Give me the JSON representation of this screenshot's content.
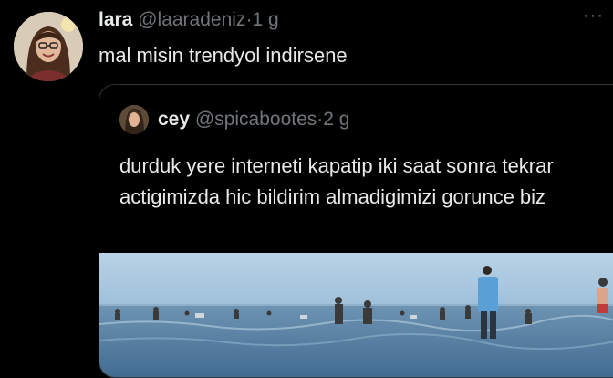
{
  "tweet": {
    "display_name": "lara",
    "handle": "@laaradeniz",
    "separator": "·",
    "time": "1 g",
    "text": "mal misin trendyol indirsene",
    "more_icon": "more-horizontal-icon"
  },
  "quoted": {
    "display_name": "cey",
    "handle": "@spicabootes",
    "separator": "·",
    "time": "2 g",
    "text": "durduk yere interneti kapatip iki saat sonra tekrar actigimizda hic bildirim almadigimizi gorunce biz"
  },
  "colors": {
    "background": "#000000",
    "text_primary": "#e7e9ea",
    "text_secondary": "#71767b",
    "border": "#2f3336"
  }
}
